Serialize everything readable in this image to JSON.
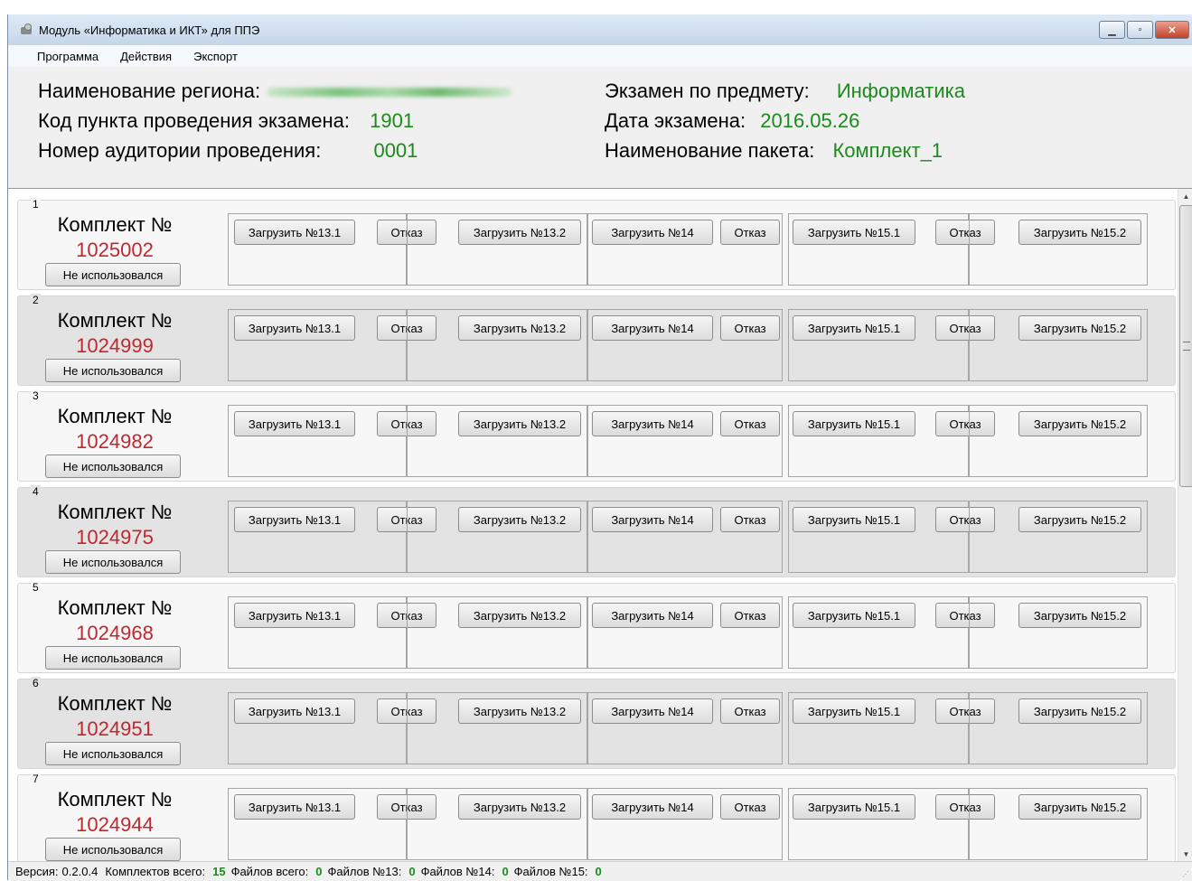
{
  "window": {
    "title": "Модуль «Информатика и ИКТ» для ППЭ"
  },
  "menu": [
    "Программа",
    "Действия",
    "Экспорт"
  ],
  "info": {
    "region_label": "Наименование региона:",
    "region_value": "",
    "ppe_code_label": "Код пункта проведения экзамена:",
    "ppe_code_value": "1901",
    "auditory_label": "Номер аудитории проведения:",
    "auditory_value": "0001",
    "subject_label": "Экзамен по предмету:",
    "subject_value": "Информатика",
    "date_label": "Дата экзамена:",
    "date_value": "2016.05.26",
    "package_label": "Наименование пакета:",
    "package_value": "Комплект_1"
  },
  "kit_label": "Комплект №",
  "unused_label": "Не использовался",
  "buttons": {
    "load_13_1": "Загрузить №13.1",
    "refuse_13": "Отказ",
    "load_13_2": "Загрузить №13.2",
    "load_14": "Загрузить №14",
    "refuse_14": "Отказ",
    "load_15_1": "Загрузить №15.1",
    "refuse_15": "Отказ",
    "load_15_2": "Загрузить №15.2"
  },
  "kits": [
    {
      "index": "1",
      "number": "1025002"
    },
    {
      "index": "2",
      "number": "1024999"
    },
    {
      "index": "3",
      "number": "1024982"
    },
    {
      "index": "4",
      "number": "1024975"
    },
    {
      "index": "5",
      "number": "1024968"
    },
    {
      "index": "6",
      "number": "1024951"
    },
    {
      "index": "7",
      "number": "1024944"
    }
  ],
  "status": {
    "version_label": "Версия:",
    "version_value": "0.2.0.4",
    "kits_total_label": "Комплектов всего:",
    "kits_total_value": "15",
    "files_total_label": "Файлов всего:",
    "files_total_value": "0",
    "files_13_label": "Файлов №13:",
    "files_13_value": "0",
    "files_14_label": "Файлов №14:",
    "files_14_value": "0",
    "files_15_label": "Файлов №15:",
    "files_15_value": "0"
  }
}
